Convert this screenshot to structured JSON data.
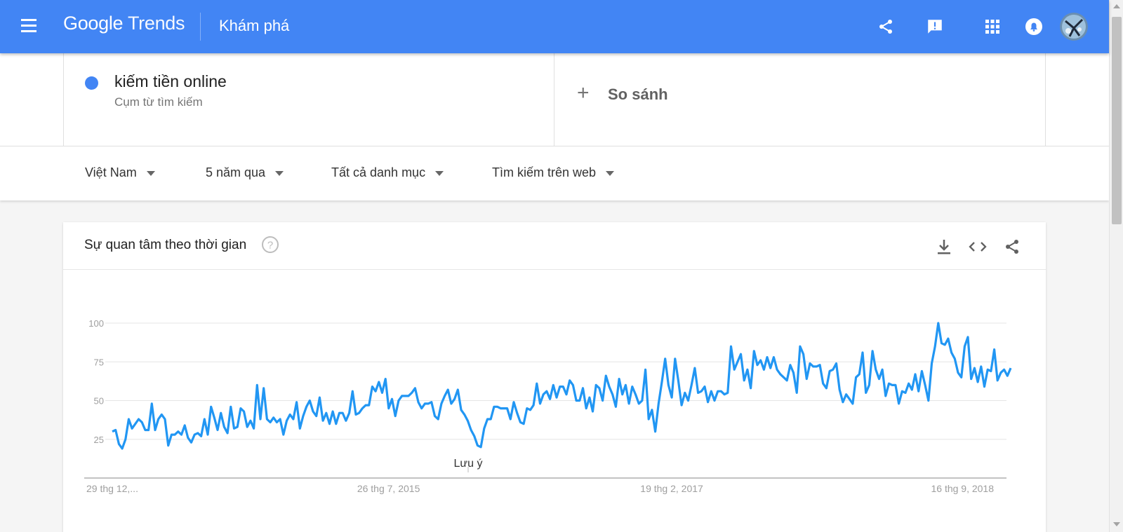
{
  "header": {
    "brand_google": "Google",
    "brand_trends": "Trends",
    "section": "Khám phá"
  },
  "search": {
    "term": "kiếm tiền online",
    "term_type": "Cụm từ tìm kiếm",
    "term_color": "#4285f4",
    "compare_label": "So sánh"
  },
  "filters": {
    "region": "Việt Nam",
    "time_range": "5 năm qua",
    "category": "Tất cả danh mục",
    "search_type": "Tìm kiếm trên web"
  },
  "card": {
    "title": "Sự quan tâm theo thời gian",
    "note_label": "Lưu ý"
  },
  "colors": {
    "header_bg": "#4285f4",
    "series_line": "#2196f3"
  },
  "icons": [
    "menu-icon",
    "share-icon",
    "feedback-icon",
    "apps-icon",
    "notifications-icon",
    "help-icon",
    "download-icon",
    "embed-icon"
  ],
  "chart_data": {
    "type": "line",
    "title": "",
    "xlabel": "",
    "ylabel": "",
    "ylim": [
      0,
      100
    ],
    "yticks": [
      25,
      50,
      75,
      100
    ],
    "grid": true,
    "x_tick_labels": [
      "29 thg 12,...",
      "26 thg 7, 2015",
      "19 thg 2, 2017",
      "16 thg 9, 2018"
    ],
    "series": [
      {
        "values": [
          30,
          31,
          22,
          19,
          25,
          38,
          32,
          35,
          38,
          36,
          31,
          31,
          48,
          31,
          38,
          41,
          38,
          21,
          28,
          28,
          30,
          28,
          34,
          26,
          23,
          28,
          29,
          27,
          38,
          28,
          46,
          39,
          31,
          42,
          33,
          29,
          46,
          32,
          33,
          45,
          43,
          33,
          37,
          32,
          60,
          38,
          58,
          38,
          36,
          39,
          36,
          38,
          28,
          37,
          41,
          38,
          49,
          32,
          40,
          46,
          50,
          43,
          40,
          52,
          37,
          42,
          35,
          43,
          35,
          42,
          42,
          37,
          42,
          56,
          41,
          42,
          45,
          47,
          47,
          59,
          56,
          62,
          55,
          64,
          45,
          51,
          40,
          50,
          53,
          53,
          53,
          55,
          58,
          49,
          45,
          48,
          48,
          49,
          40,
          38,
          48,
          53,
          57,
          48,
          51,
          57,
          44,
          41,
          37,
          31,
          27,
          21,
          20,
          32,
          38,
          38,
          46,
          46,
          45,
          45,
          45,
          38,
          49,
          42,
          36,
          35,
          45,
          44,
          47,
          61,
          48,
          54,
          56,
          51,
          60,
          52,
          59,
          59,
          54,
          63,
          60,
          50,
          50,
          58,
          45,
          52,
          43,
          60,
          58,
          50,
          66,
          59,
          54,
          46,
          64,
          54,
          60,
          48,
          59,
          54,
          48,
          50,
          70,
          38,
          44,
          30,
          48,
          62,
          77,
          60,
          52,
          77,
          63,
          47,
          55,
          50,
          60,
          71,
          55,
          56,
          59,
          49,
          56,
          50,
          56,
          56,
          54,
          55,
          85,
          70,
          75,
          80,
          63,
          70,
          58,
          82,
          73,
          76,
          70,
          78,
          71,
          78,
          70,
          67,
          65,
          63,
          73,
          68,
          55,
          85,
          80,
          64,
          74,
          72,
          72,
          73,
          61,
          58,
          69,
          70,
          74,
          57,
          49,
          54,
          51,
          48,
          65,
          67,
          81,
          55,
          60,
          82,
          70,
          64,
          70,
          53,
          61,
          60,
          60,
          48,
          56,
          55,
          61,
          57,
          67,
          56,
          69,
          60,
          50,
          74,
          85,
          100,
          87,
          86,
          90,
          81,
          77,
          68,
          65,
          85,
          91,
          64,
          71,
          62,
          72,
          59,
          70,
          69,
          83,
          63,
          68,
          70,
          66,
          71
        ]
      }
    ]
  }
}
